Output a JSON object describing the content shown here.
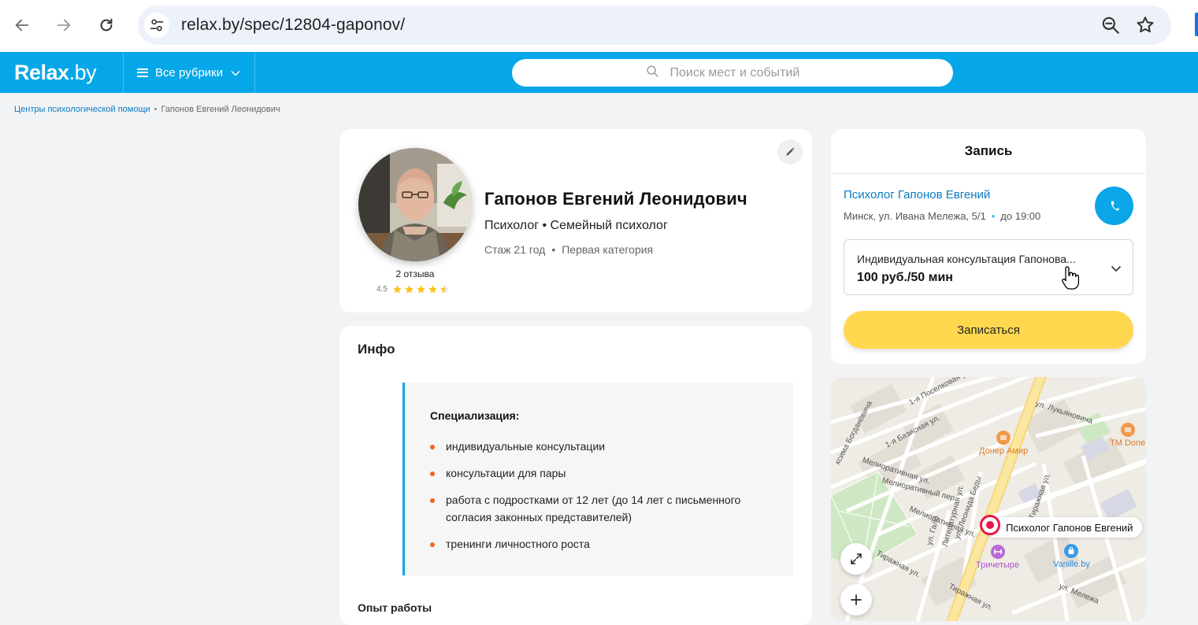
{
  "browser": {
    "url": "relax.by/spec/12804-gaponov/"
  },
  "header": {
    "logo_main": "Relax",
    "logo_suffix": ".by",
    "rubrics_label": "Все рубрики",
    "search_placeholder": "Поиск мест и событий"
  },
  "breadcrumb": {
    "parent": "Центры психологической помощи",
    "separator": "•",
    "current": "Гапонов Евгений Леонидович"
  },
  "profile": {
    "name": "Гапонов Евгений Леонидович",
    "role": "Психолог • Семейный психолог",
    "experience": "Стаж 21 год",
    "bullet": "•",
    "category": "Первая категория",
    "reviews": "2 отзыва",
    "rating": "4.5",
    "rating_value": 4.5,
    "rating_max": 5
  },
  "info": {
    "title": "Инфо",
    "spec_title": "Специализация:",
    "spec_items": [
      "индивидуальные консультации",
      "консультации для пары",
      "работа с подростками от 12 лет (до 14 лет с письменного согласия законных представителей)",
      "тренинги личностного роста"
    ],
    "next_section": "Опыт работы"
  },
  "booking": {
    "title": "Запись",
    "place_name": "Психолог Гапонов Евгений",
    "address": "Минск, ул. Ивана Мележа, 5/1",
    "hours": "до 19:00",
    "service_name": "Индивидуальная консультация Гапонова...",
    "service_price": "100 руб./50 мин",
    "book_button": "Записаться"
  },
  "map": {
    "pin_label": "Психолог Гапонов Евгений",
    "poi": [
      {
        "label": "Донер Амир"
      },
      {
        "label": "TM Done"
      },
      {
        "label": "Тричетыре"
      },
      {
        "label": "Vanille.by"
      }
    ],
    "streets": [
      "1-я Поселковая ул.",
      "ул. Лукьяновича",
      "1-я Базисная ул.",
      "Мелиоративная ул.",
      "Мелиоративный пер.",
      "Мелиоративная ул.",
      "ул. Леонида Беды",
      "Литературная ул.",
      "Тиражная ул.",
      "ул. Гало",
      "Тиражная ул.",
      "ул. Мележа",
      "ксима Богдановича",
      "Тиражная ул."
    ]
  },
  "colors": {
    "header_bg": "#06a7e8",
    "link": "#0a7cc4",
    "book_button": "#ffd84f",
    "bullet": "#f26522",
    "pin": "#e8174a"
  }
}
